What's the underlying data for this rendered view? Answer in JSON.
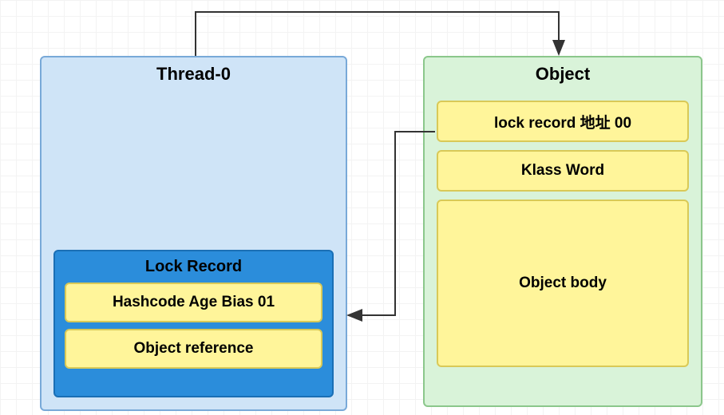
{
  "thread": {
    "title": "Thread-0",
    "lock_record": {
      "title": "Lock Record",
      "fields": {
        "hashcode": "Hashcode Age Bias 01",
        "reference": "Object reference"
      }
    }
  },
  "object": {
    "title": "Object",
    "fields": {
      "lock_addr": "lock record 地址 00",
      "klass": "Klass Word",
      "body": "Object body"
    }
  }
}
